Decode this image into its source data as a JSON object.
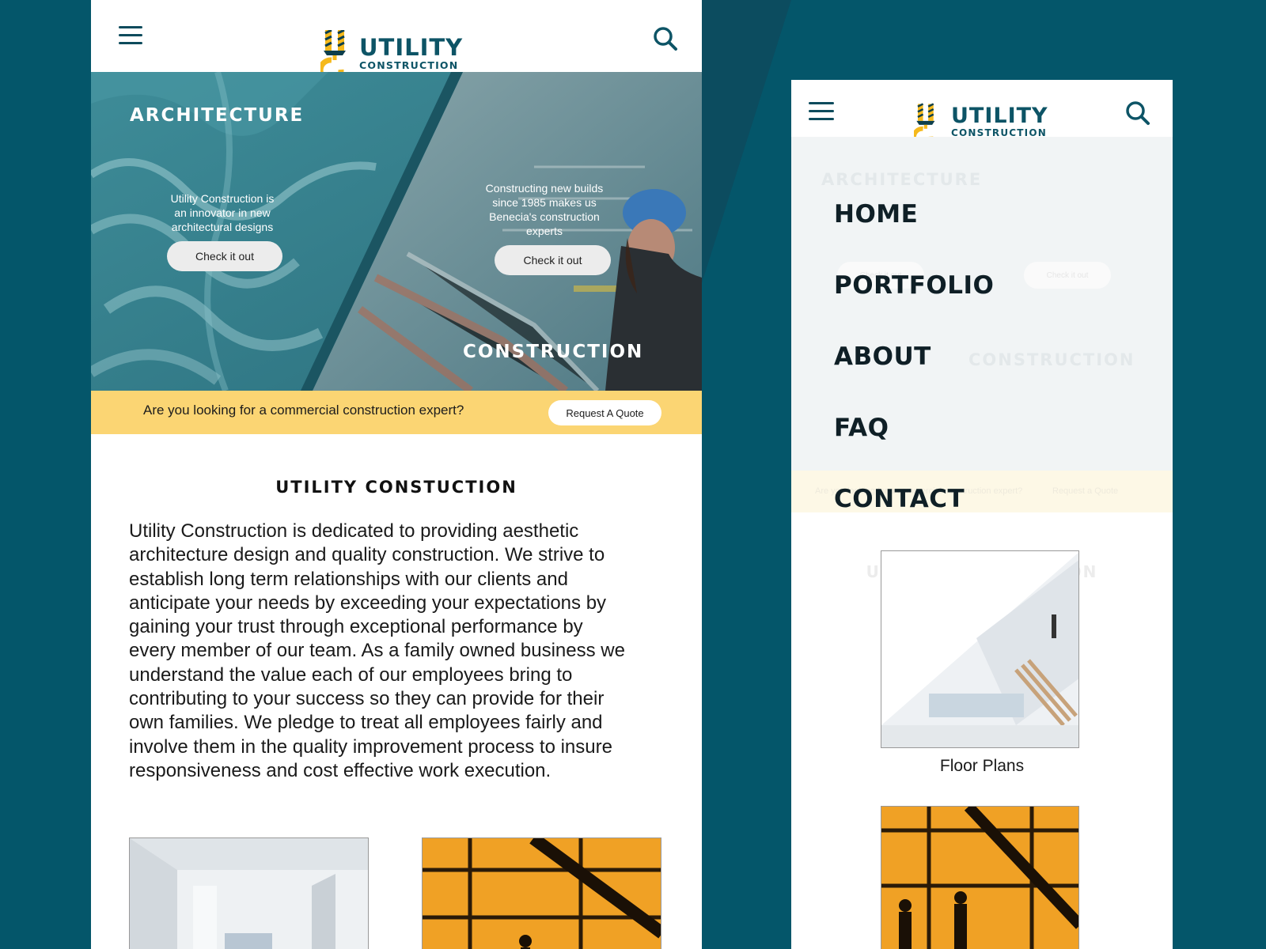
{
  "brand": {
    "name": "UTILITY",
    "tagline": "CONSTRUCTION",
    "colors": {
      "teal": "#0d5466",
      "yellow": "#f5b91c",
      "background": "#04566a",
      "banner": "#fbd573"
    }
  },
  "left": {
    "header": {
      "menu_icon": "hamburger-icon",
      "search_icon": "search-icon"
    },
    "hero": {
      "left_heading": "ARCHITECTURE",
      "left_text_lines": [
        "Utility Construction is",
        "an innovator in new",
        "architectural designs"
      ],
      "left_button": "Check it out",
      "right_heading": "CONSTRUCTION",
      "right_text_lines": [
        "Constructing new builds",
        "since 1985 makes us",
        "Benecia's construction",
        "experts"
      ],
      "right_button": "Check it out"
    },
    "banner": {
      "text": "Are you looking for a commercial construction expert?",
      "button": "Request A Quote"
    },
    "section_title": "UTILITY CONSTUCTION",
    "about_lines": [
      "Utility Construction is dedicated to providing aesthetic",
      "architecture design and quality construction. We strive to",
      "establish long term relationships with our clients and",
      "anticipate your needs by exceeding your expectations by",
      "gaining your trust through exceptional performance by",
      "every member of our team. As a family owned business we",
      "understand the value each of our employees bring to",
      "contributing to your success so they can provide for their",
      "own families. We pledge to treat all employees fairly and",
      "involve them in the quality improvement process to insure",
      "responsiveness and cost effective work execution."
    ]
  },
  "right": {
    "menu": [
      "HOME",
      "PORTFOLIO",
      "ABOUT",
      "FAQ",
      "CONTACT"
    ],
    "ghost": {
      "architecture": "ARCHITECTURE",
      "construction": "CONSTRUCTION",
      "button": "Check it out",
      "banner_text": "Are you looking for a commercial construction expert?",
      "banner_button": "Request a Quote",
      "section_title": "UTILITY CONSTUCTION"
    },
    "cards": [
      {
        "label": "Floor Plans"
      }
    ]
  }
}
